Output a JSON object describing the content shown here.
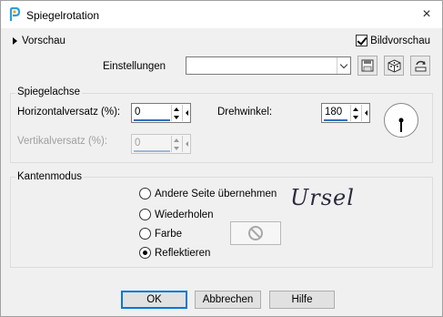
{
  "window": {
    "title": "Spiegelrotation",
    "close_icon": "×"
  },
  "preview": {
    "label": "Vorschau",
    "bild_label": "Bildvorschau",
    "bild_checked": true
  },
  "settings": {
    "label": "Einstellungen",
    "value": ""
  },
  "mirror_axis": {
    "label": "Spiegelachse",
    "horizontal_label": "Horizontalversatz (%):",
    "horizontal_value": "0",
    "vertical_label": "Vertikalversatz (%):",
    "vertical_value": "0",
    "rotation_label": "Drehwinkel:",
    "rotation_value": "180"
  },
  "edge_mode": {
    "label": "Kantenmodus",
    "options": [
      {
        "label": "Andere Seite übernehmen",
        "selected": false
      },
      {
        "label": "Wiederholen",
        "selected": false
      },
      {
        "label": "Farbe",
        "selected": false
      },
      {
        "label": "Reflektieren",
        "selected": true
      }
    ],
    "signature": "Ursel"
  },
  "buttons": {
    "ok": "OK",
    "cancel": "Abbrechen",
    "help": "Hilfe"
  }
}
